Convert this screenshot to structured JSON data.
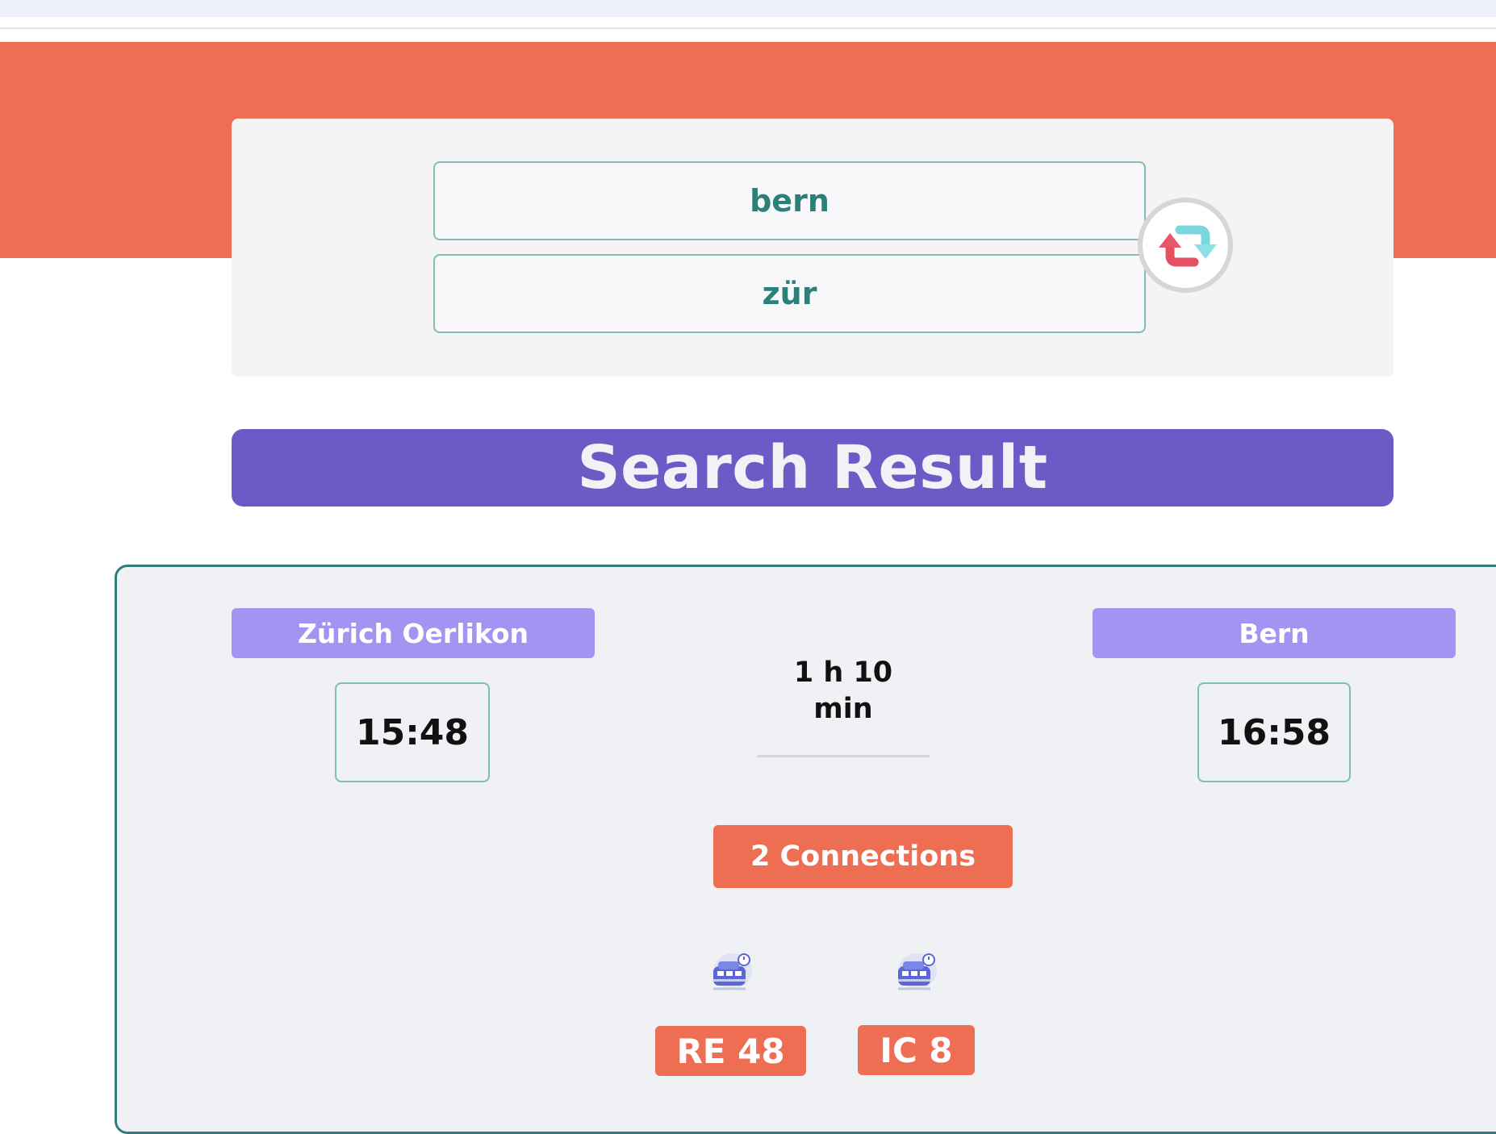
{
  "search": {
    "from_value": "bern",
    "to_value": "zür",
    "swap_icon": "swap-arrows-icon"
  },
  "result": {
    "title": "Search Result"
  },
  "connection": {
    "departure_station": "Zürich Oerlikon",
    "departure_time": "15:48",
    "duration_line1": "1 h 10",
    "duration_line2": "min",
    "arrival_station": "Bern",
    "arrival_time": "16:58",
    "connections_label": "2 Connections",
    "legs": [
      {
        "line": "RE 48",
        "icon": "train-icon"
      },
      {
        "line": "IC 8",
        "icon": "train-icon"
      }
    ]
  },
  "colors": {
    "hero": "#ee6e53",
    "banner": "#6a5bc6",
    "station_badge": "#a593f2",
    "accent_teal": "#2e7f7a"
  }
}
